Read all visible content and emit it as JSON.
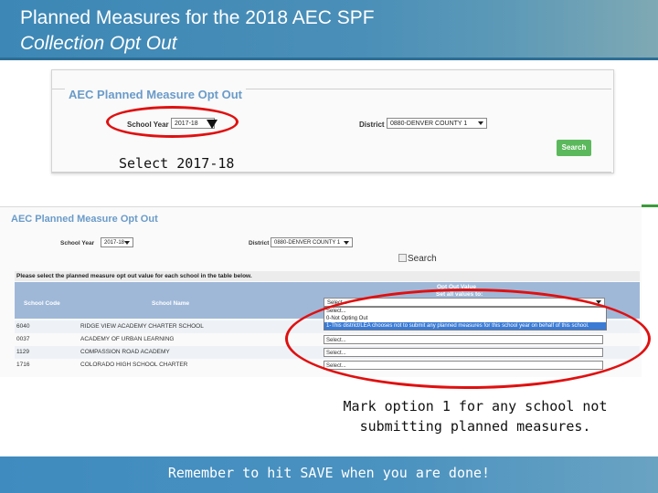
{
  "title": {
    "line1": "Planned Measures for the 2018 AEC SPF",
    "line2": "Collection Opt Out"
  },
  "screenshot1": {
    "panel_title": "AEC Planned Measure Opt Out",
    "school_year_label": "School Year",
    "school_year_value": "2017-18",
    "district_label": "District",
    "district_value": "0880-DENVER COUNTY 1",
    "search_button": "Search"
  },
  "caption1": "Select 2017-18",
  "screenshot2": {
    "panel_title": "AEC Planned Measure Opt Out",
    "school_year_label": "School Year",
    "school_year_value": "2017-18",
    "district_label": "District",
    "district_value": "0880-DENVER COUNTY 1",
    "search_alt": "Search",
    "instruction": "Please select the planned measure opt out value for each school in the table below.",
    "columns": {
      "school_code": "School Code",
      "school_name": "School Name",
      "opt_out_value": "Opt Out Value",
      "set_all": "Set all values to:"
    },
    "set_all_select": "Select...",
    "dropdown_options": [
      "Select...",
      "0-Not Opting Out",
      "1-This district/LEA chooses not to submit any planned measures for this school year on behalf of this school."
    ],
    "rows": [
      {
        "code": "6040",
        "name": "RIDGE VIEW ACADEMY CHARTER SCHOOL",
        "value": "Select..."
      },
      {
        "code": "0037",
        "name": "ACADEMY OF URBAN LEARNING",
        "value": "Select..."
      },
      {
        "code": "1129",
        "name": "COMPASSION ROAD ACADEMY",
        "value": "Select..."
      },
      {
        "code": "1716",
        "name": "COLORADO HIGH SCHOOL CHARTER",
        "value": "Select..."
      }
    ]
  },
  "caption2": "Mark option 1 for any school not submitting planned measures.",
  "footer": "Remember to hit SAVE when you are done!",
  "colors": {
    "title_bar": "#3c87b6",
    "panel_title": "#6a9bc9",
    "table_header": "#9fb8d8",
    "search_button": "#5cb85c",
    "highlight_oval": "#e01010"
  }
}
